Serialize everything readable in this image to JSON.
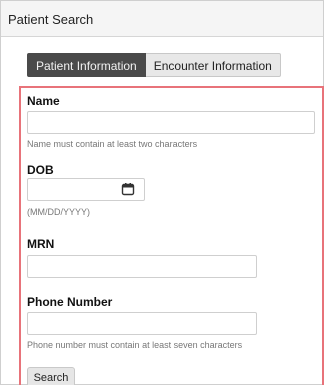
{
  "panel": {
    "title": "Patient Search"
  },
  "tabs": [
    {
      "label": "Patient Information",
      "active": true
    },
    {
      "label": "Encounter Information",
      "active": false
    }
  ],
  "form": {
    "name": {
      "label": "Name",
      "value": "",
      "help": "Name must contain at least two characters"
    },
    "dob": {
      "label": "DOB",
      "value": "",
      "help": "(MM/DD/YYYY)",
      "icon": "calendar-icon"
    },
    "mrn": {
      "label": "MRN",
      "value": ""
    },
    "phone": {
      "label": "Phone Number",
      "value": "",
      "help": "Phone number must contain at least seven characters"
    },
    "search_label": "Search"
  },
  "colors": {
    "highlight_border": "#e8737a",
    "active_tab": "#4a4a4a"
  }
}
